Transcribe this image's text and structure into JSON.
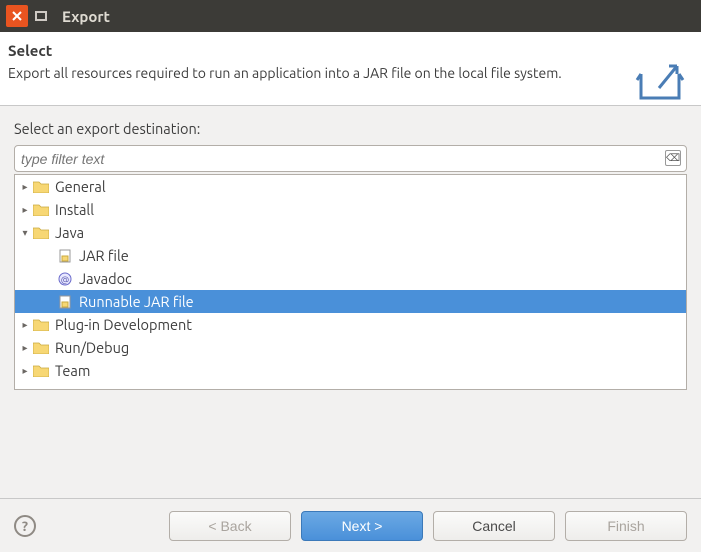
{
  "window": {
    "title": "Export"
  },
  "banner": {
    "title": "Select",
    "description": "Export all resources required to run an application into a JAR file on the local file system."
  },
  "content": {
    "label": "Select an export destination:",
    "filter_placeholder": "type filter text"
  },
  "tree": {
    "nodes": [
      {
        "label": "General",
        "type": "folder",
        "expanded": false,
        "depth": 0
      },
      {
        "label": "Install",
        "type": "folder",
        "expanded": false,
        "depth": 0
      },
      {
        "label": "Java",
        "type": "folder",
        "expanded": true,
        "depth": 0
      },
      {
        "label": "JAR file",
        "type": "leaf",
        "depth": 1,
        "icon": "jar"
      },
      {
        "label": "Javadoc",
        "type": "leaf",
        "depth": 1,
        "icon": "javadoc"
      },
      {
        "label": "Runnable JAR file",
        "type": "leaf",
        "depth": 1,
        "icon": "runjar",
        "selected": true
      },
      {
        "label": "Plug-in Development",
        "type": "folder",
        "expanded": false,
        "depth": 0
      },
      {
        "label": "Run/Debug",
        "type": "folder",
        "expanded": false,
        "depth": 0
      },
      {
        "label": "Team",
        "type": "folder",
        "expanded": false,
        "depth": 0
      }
    ]
  },
  "buttons": {
    "back": "< Back",
    "next": "Next >",
    "cancel": "Cancel",
    "finish": "Finish",
    "help_tooltip": "Help"
  }
}
